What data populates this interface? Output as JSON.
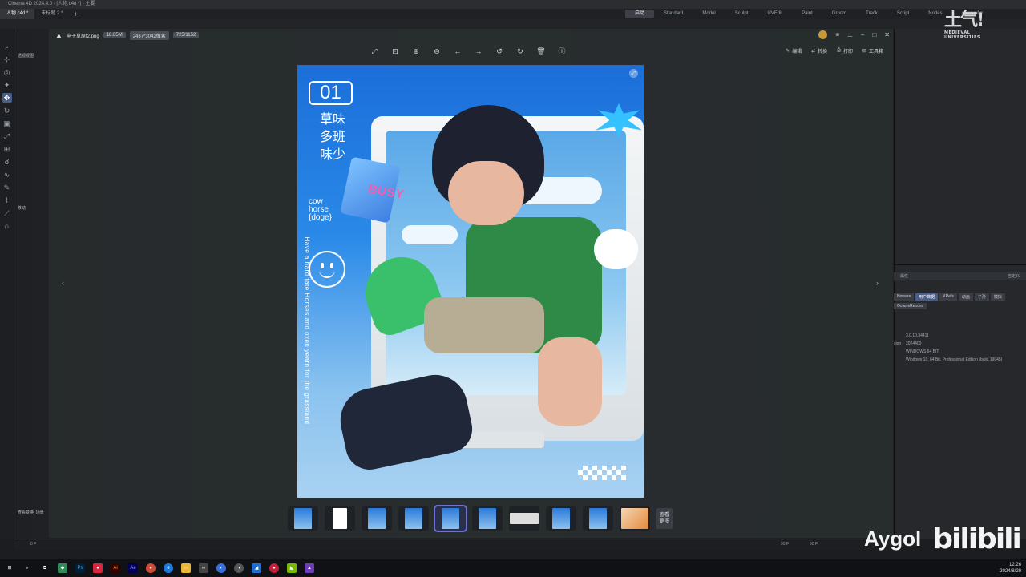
{
  "app": {
    "title": "Cinema 4D 2024.4.0 - [人物.c4d *] - 主要",
    "tabs": [
      "人物.c4d *",
      "未标题 2 *"
    ],
    "layouts": [
      "启动",
      "Standard",
      "Model",
      "Sculpt",
      "UVEdit",
      "Paint",
      "Groom",
      "Track",
      "Script",
      "Nodes",
      "octane for"
    ],
    "active_layout": "启动"
  },
  "logo": {
    "glyph": "土气!",
    "sub1": "MEDIEVAL",
    "sub2": "UNIVERSITIES"
  },
  "viewport": {
    "label": "透视视图",
    "move_label": "移动",
    "scene_label": "查看变换: 场景"
  },
  "attributes": {
    "header": "属性",
    "tabs": [
      "Noware",
      "用户数据",
      "XRefs",
      "动画",
      "子孙",
      "模拟"
    ],
    "active_tab": "用户数据",
    "render_tab": "OctaneRender",
    "dropdown": "自定义",
    "info": [
      {
        "key": "",
        "value": "3.0.10.34411"
      },
      {
        "key": "sion",
        "value": "2024400"
      },
      {
        "key": "",
        "value": "WINDOWS 64 BIT"
      },
      {
        "key": "",
        "value": "Windows 10, 64 Bit, Professional Edition (build 19045)"
      }
    ]
  },
  "timeline": {
    "start": "0 F",
    "end": "90 F",
    "end2": "90 F"
  },
  "viewer": {
    "filename": "电子草原f2.png",
    "size": "18.85M",
    "dimensions": "2437*3042像素",
    "index": "725/1152",
    "actions": [
      {
        "icon": "edit-icon",
        "label": "编辑"
      },
      {
        "icon": "convert-icon",
        "label": "转换"
      },
      {
        "icon": "print-icon",
        "label": "打印"
      },
      {
        "icon": "toolbox-icon",
        "label": "工具箱"
      }
    ]
  },
  "poster": {
    "number": "01",
    "chinese": [
      "草味",
      "多班",
      "味少"
    ],
    "english1": [
      "cow",
      "horse",
      "{doge}"
    ],
    "vertical": "Have a hard fate Horses and oxen yearn for the grassland",
    "busy": "BUSY"
  },
  "thumbs": {
    "more_label": [
      "查看",
      "更多"
    ],
    "active_index": 4
  },
  "taskbar": {
    "time": "12:26",
    "date": "2024/8/29"
  },
  "watermark": {
    "author": "Aygol",
    "site": "bilibili"
  },
  "colors": {
    "accent": "#4a5e8a",
    "poster_blue": "#1b6ed9",
    "thumb_active": "#6f6fd8"
  }
}
